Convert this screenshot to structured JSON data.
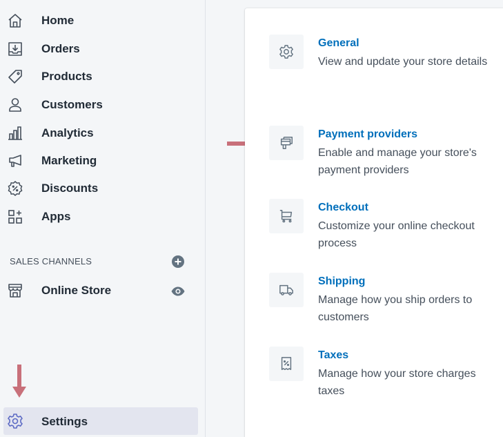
{
  "sidebar": {
    "items": [
      {
        "label": "Home",
        "icon": "home-icon"
      },
      {
        "label": "Orders",
        "icon": "orders-icon"
      },
      {
        "label": "Products",
        "icon": "products-icon"
      },
      {
        "label": "Customers",
        "icon": "customers-icon"
      },
      {
        "label": "Analytics",
        "icon": "analytics-icon"
      },
      {
        "label": "Marketing",
        "icon": "marketing-icon"
      },
      {
        "label": "Discounts",
        "icon": "discounts-icon"
      },
      {
        "label": "Apps",
        "icon": "apps-icon"
      }
    ],
    "sales_channels_header": "SALES CHANNELS",
    "online_store_label": "Online Store",
    "settings_label": "Settings"
  },
  "settings": [
    {
      "title": "General",
      "description": "View and update your store details",
      "icon": "gear-icon"
    },
    {
      "title": "Payment providers",
      "description": "Enable and manage your store's payment providers",
      "icon": "payment-icon"
    },
    {
      "title": "Checkout",
      "description": "Customize your online checkout process",
      "icon": "cart-icon"
    },
    {
      "title": "Shipping",
      "description": "Manage how you ship orders to customers",
      "icon": "truck-icon"
    },
    {
      "title": "Taxes",
      "description": "Manage how your store charges taxes",
      "icon": "receipt-icon"
    }
  ],
  "colors": {
    "link": "#006fbb",
    "annotation_arrow": "#c8707a",
    "active_bg": "#e3e5ef"
  }
}
